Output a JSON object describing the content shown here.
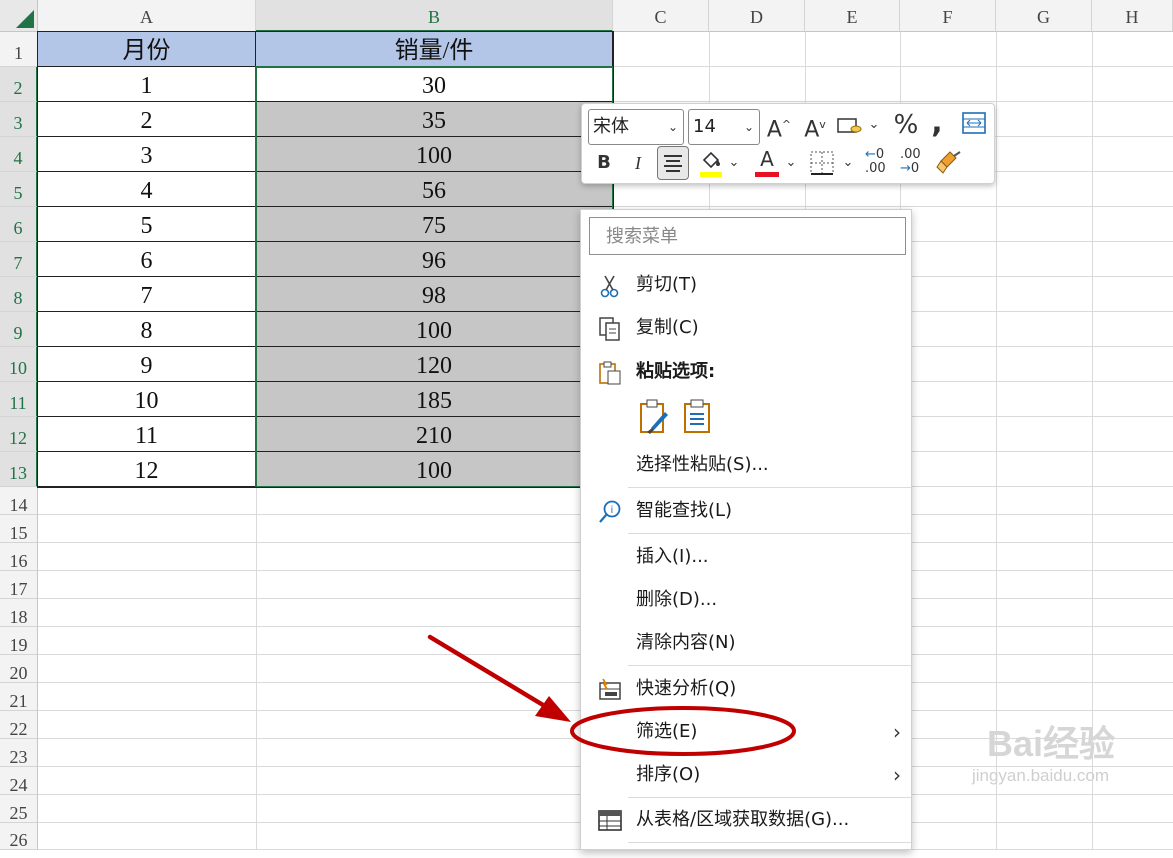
{
  "sheet": {
    "columns": [
      "A",
      "B",
      "C",
      "D",
      "E",
      "F",
      "G",
      "H"
    ],
    "rows": [
      "1",
      "2",
      "3",
      "4",
      "5",
      "6",
      "7",
      "8",
      "9",
      "10",
      "11",
      "12",
      "13",
      "14",
      "15",
      "16",
      "17",
      "18",
      "19",
      "20",
      "21",
      "22",
      "23",
      "24",
      "25",
      "26"
    ],
    "headers": {
      "month": "月份",
      "sales": "销量/件"
    },
    "months": [
      "1",
      "2",
      "3",
      "4",
      "5",
      "6",
      "7",
      "8",
      "9",
      "10",
      "11",
      "12"
    ],
    "sales": [
      "30",
      "35",
      "100",
      "56",
      "75",
      "96",
      "98",
      "100",
      "120",
      "185",
      "210",
      "100"
    ]
  },
  "mini_toolbar": {
    "font_name": "宋体",
    "font_size": "14",
    "grow_font_icon": "font-grow-icon",
    "shrink_font_icon": "font-shrink-icon",
    "accent_highlight": "#ffff00",
    "accent_font_color": "#e81123"
  },
  "context_menu": {
    "search_placeholder": "搜索菜单",
    "cut": "剪切(T)",
    "copy": "复制(C)",
    "paste_options": "粘贴选项:",
    "paste_special": "选择性粘贴(S)...",
    "smart_lookup": "智能查找(L)",
    "insert": "插入(I)...",
    "delete": "删除(D)...",
    "clear": "清除内容(N)",
    "quick_analysis": "快速分析(Q)",
    "filter": "筛选(E)",
    "sort": "排序(O)",
    "get_data": "从表格/区域获取数据(G)..."
  },
  "annotation": {
    "color": "#c00000"
  },
  "watermark": {
    "text": "Bai经验",
    "sub": "jingyan.baidu.com"
  }
}
